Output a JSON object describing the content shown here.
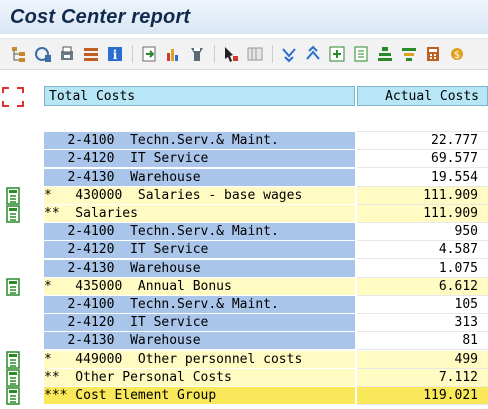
{
  "window": {
    "title": "Cost Center report"
  },
  "toolbar": {
    "icons": [
      "hierarchy-icon",
      "navigate-icon",
      "print-preview-icon",
      "layout-icon",
      "info-icon",
      "export-icon",
      "chart-icon",
      "print-icon",
      "select-icon",
      "columns-icon",
      "collapse-icon",
      "expand-icon",
      "add-node-icon",
      "node-icon",
      "filter-icon",
      "sort-icon",
      "calculator-icon",
      "currency-icon"
    ]
  },
  "table": {
    "columns": {
      "left": "Total Costs",
      "right": "Actual Costs"
    },
    "rows": [
      {
        "style": "blank",
        "label": "",
        "value": ""
      },
      {
        "style": "blue",
        "label": "   2-4100  Techn.Serv.& Maint.",
        "value": "22.777"
      },
      {
        "style": "blue",
        "label": "   2-4120  IT Service",
        "value": "69.577"
      },
      {
        "style": "blue",
        "label": "   2-4130  Warehouse",
        "value": "19.554"
      },
      {
        "style": "yellow",
        "label": "*   430000  Salaries - base wages",
        "value": "111.909"
      },
      {
        "style": "yellow",
        "label": "**  Salaries",
        "value": "111.909"
      },
      {
        "style": "blue",
        "label": "   2-4100  Techn.Serv.& Maint.",
        "value": "950"
      },
      {
        "style": "blue",
        "label": "   2-4120  IT Service",
        "value": "4.587"
      },
      {
        "style": "blue",
        "label": "   2-4130  Warehouse",
        "value": "1.075"
      },
      {
        "style": "yellow",
        "label": "*   435000  Annual Bonus",
        "value": "6.612"
      },
      {
        "style": "blue",
        "label": "   2-4100  Techn.Serv.& Maint.",
        "value": "105"
      },
      {
        "style": "blue",
        "label": "   2-4120  IT Service",
        "value": "313"
      },
      {
        "style": "blue",
        "label": "   2-4130  Warehouse",
        "value": "81"
      },
      {
        "style": "yellow",
        "label": "*   449000  Other personnel costs",
        "value": "499"
      },
      {
        "style": "yellow",
        "label": "**  Other Personal Costs",
        "value": "7.112"
      },
      {
        "style": "gold",
        "label": "*** Cost Element Group",
        "value": "119.021"
      }
    ]
  },
  "gutter": {
    "expand_rows": [
      4,
      5,
      9,
      13,
      14,
      15
    ]
  }
}
